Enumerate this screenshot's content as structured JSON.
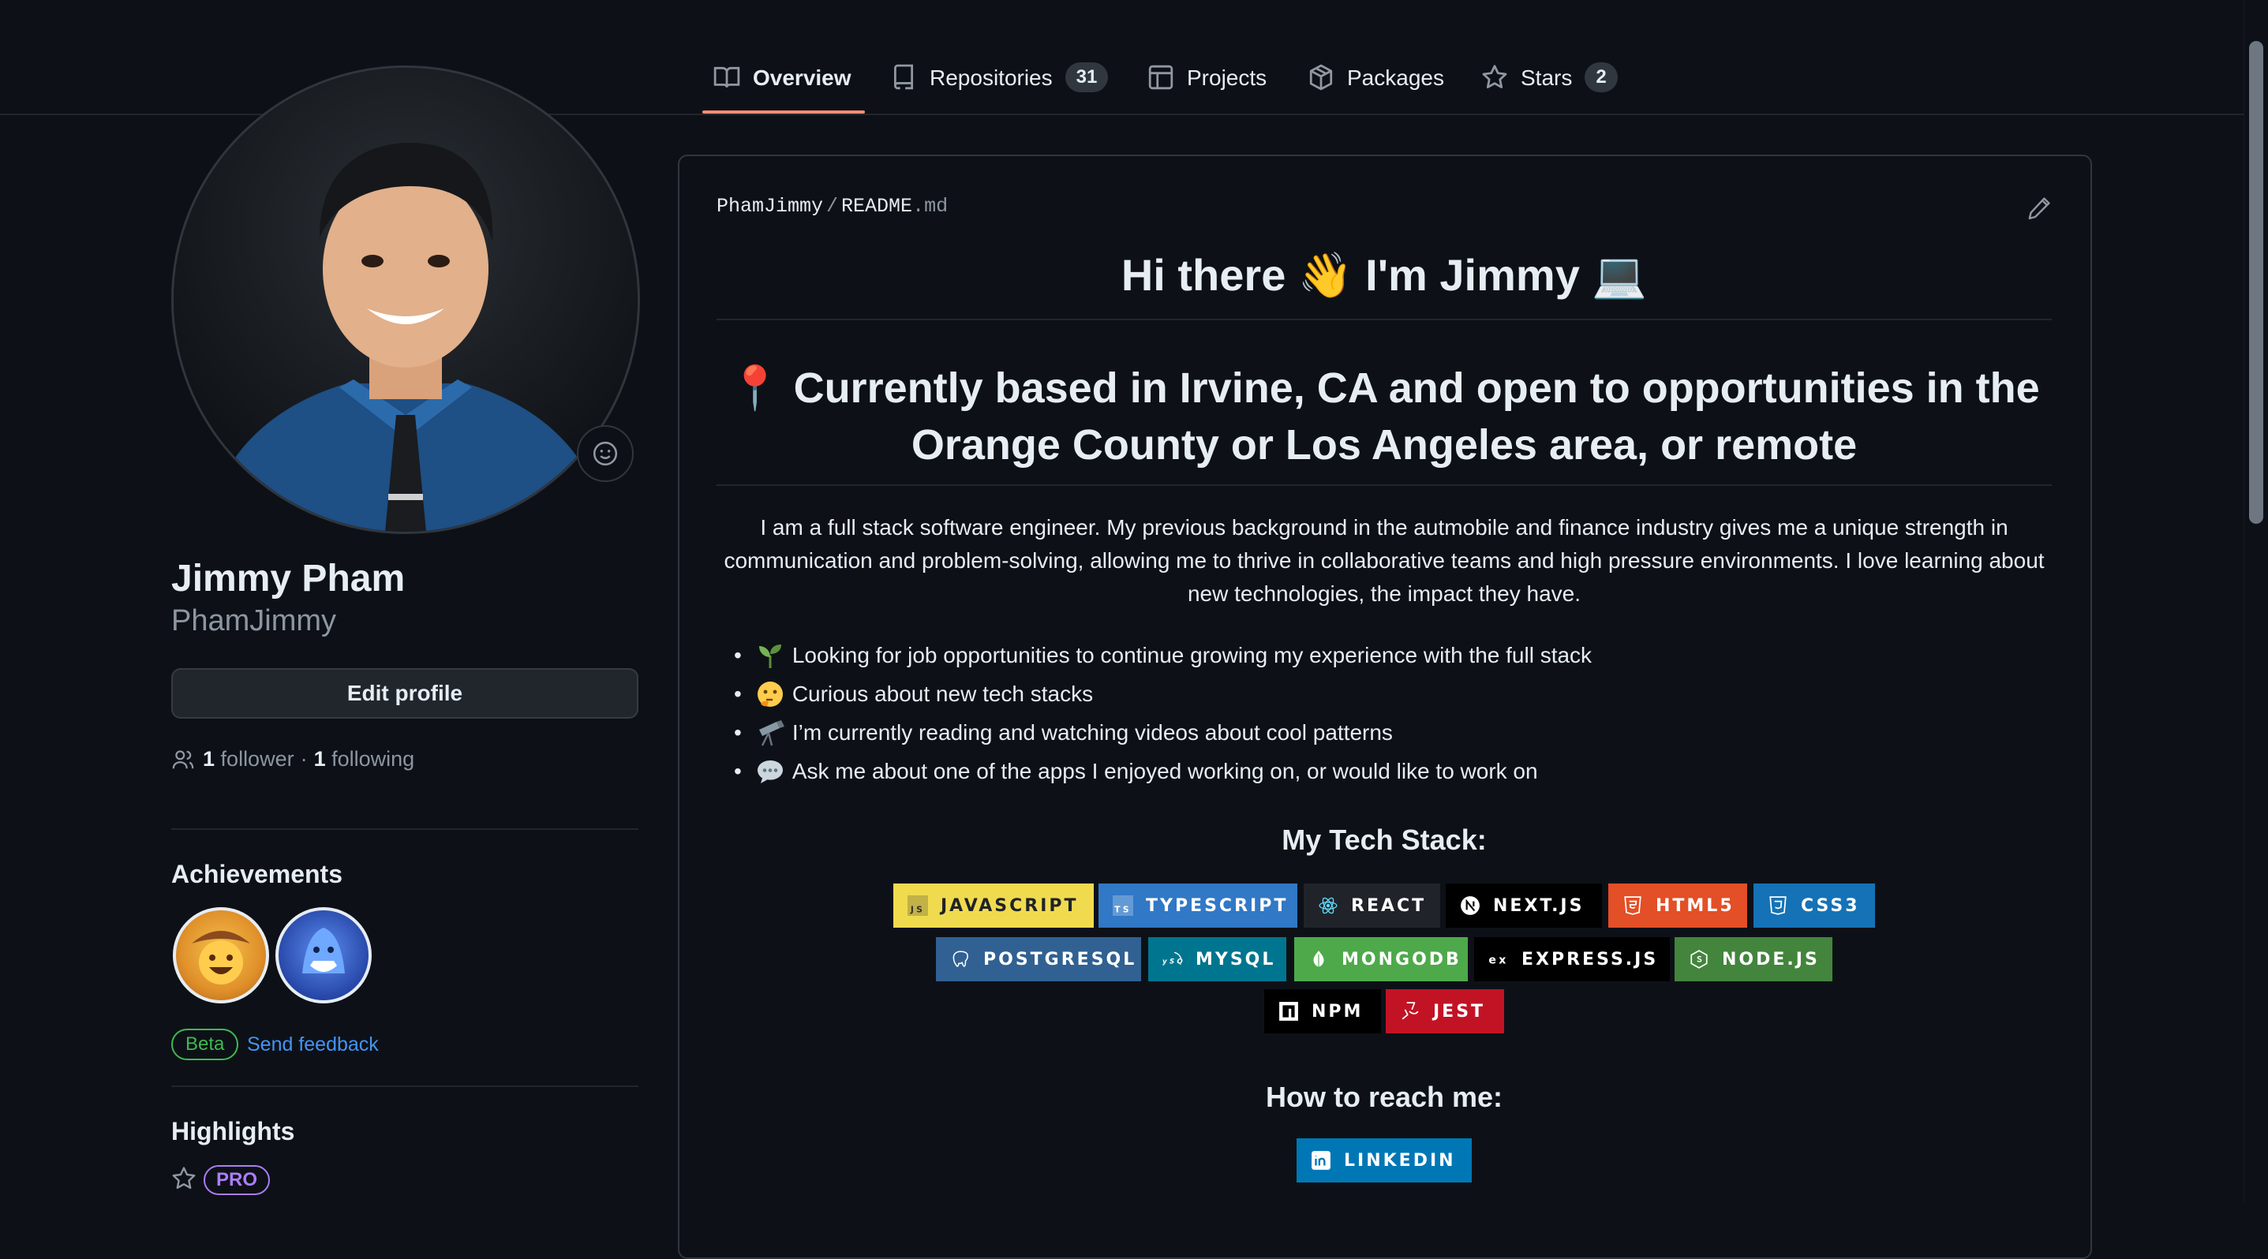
{
  "nav": {
    "tabs": [
      {
        "label": "Overview",
        "icon": "book-icon",
        "active": true
      },
      {
        "label": "Repositories",
        "icon": "repo-icon",
        "count": "31"
      },
      {
        "label": "Projects",
        "icon": "table-icon"
      },
      {
        "label": "Packages",
        "icon": "package-icon"
      },
      {
        "label": "Stars",
        "icon": "star-icon",
        "count": "2"
      }
    ]
  },
  "sidebar": {
    "full_name": "Jimmy Pham",
    "username": "PhamJimmy",
    "edit_profile": "Edit profile",
    "followers_count": "1",
    "followers_label": "follower",
    "dot": "·",
    "following_count": "1",
    "following_label": "following",
    "achievements_title": "Achievements",
    "beta_label": "Beta",
    "send_feedback": "Send feedback",
    "highlights_title": "Highlights",
    "pro_label": "PRO"
  },
  "readme": {
    "path_owner": "PhamJimmy",
    "path_sep": "/",
    "path_file": "README",
    "path_ext": ".md",
    "greeting": "Hi there 👋 I'm Jimmy 💻",
    "location_line1": "📍 Currently based in Irvine, CA and open to opportunities in the",
    "location_line2": "Orange County or Los Angeles area, or remote",
    "intro": "I am a full stack software engineer. My previous background in the autmobile and finance industry gives me a unique strength in communication and problem-solving, allowing me to thrive in collaborative teams and high pressure environments. I love learning about new technologies, the impact they have.",
    "bullets": [
      "Looking for job opportunities to continue growing my experience with the full stack",
      "Curious about new tech stacks",
      "I’m currently reading and watching videos about cool patterns",
      "Ask me about one of the apps I enjoyed working on, or would like to work on"
    ],
    "tech_stack_title": "My Tech Stack:",
    "badges": [
      {
        "label": "JAVASCRIPT",
        "color": "#f0db4f",
        "text": "#1f2328"
      },
      {
        "label": "TYPESCRIPT",
        "color": "#3178c6",
        "text": "#ffffff"
      },
      {
        "label": "REACT",
        "color": "#20232a",
        "text": "#ffffff"
      },
      {
        "label": "NEXT.JS",
        "color": "#000000",
        "text": "#ffffff"
      },
      {
        "label": "HTML5",
        "color": "#e34f26",
        "text": "#ffffff"
      },
      {
        "label": "CSS3",
        "color": "#1572b6",
        "text": "#ffffff"
      },
      {
        "label": "POSTGRESQL",
        "color": "#316192",
        "text": "#ffffff"
      },
      {
        "label": "MYSQL",
        "color": "#00758f",
        "text": "#ffffff"
      },
      {
        "label": "MONGODB",
        "color": "#4ea94b",
        "text": "#ffffff"
      },
      {
        "label": "EXPRESS.JS",
        "color": "#000000",
        "text": "#ffffff"
      },
      {
        "label": "NODE.JS",
        "color": "#43853d",
        "text": "#ffffff"
      },
      {
        "label": "NPM",
        "color": "#000000",
        "text": "#ffffff"
      },
      {
        "label": "JEST",
        "color": "#c21325",
        "text": "#ffffff"
      }
    ],
    "reach_title": "How to reach me:",
    "linkedin": {
      "label": "LINKEDIN",
      "color": "#0077b5"
    }
  }
}
